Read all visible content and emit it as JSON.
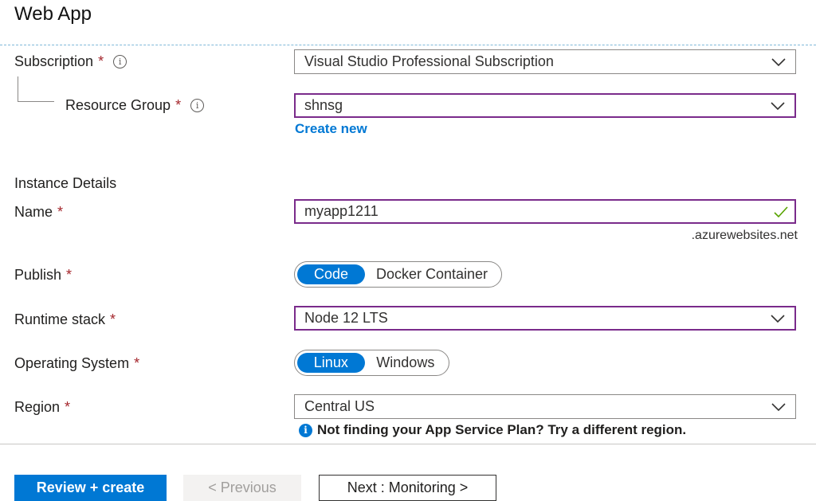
{
  "page": {
    "title": "Web App"
  },
  "subscription": {
    "label": "Subscription",
    "required": "*",
    "value": "Visual Studio Professional Subscription"
  },
  "resource_group": {
    "label": "Resource Group",
    "required": "*",
    "value": "shnsg",
    "create_new": "Create new"
  },
  "instance_details": {
    "heading": "Instance Details",
    "name": {
      "label": "Name",
      "required": "*",
      "value": "myapp1211",
      "suffix": ".azurewebsites.net"
    },
    "publish": {
      "label": "Publish",
      "required": "*",
      "options": [
        "Code",
        "Docker Container"
      ],
      "selected": "Code"
    },
    "runtime_stack": {
      "label": "Runtime stack",
      "required": "*",
      "value": "Node 12 LTS"
    },
    "os": {
      "label": "Operating System",
      "required": "*",
      "options": [
        "Linux",
        "Windows"
      ],
      "selected": "Linux"
    },
    "region": {
      "label": "Region",
      "required": "*",
      "value": "Central US",
      "hint": "Not finding your App Service Plan? Try a different region."
    }
  },
  "footer": {
    "review_create": "Review + create",
    "previous": "< Previous",
    "next": "Next : Monitoring >"
  },
  "colors": {
    "accent": "#0078d4",
    "focus_border": "#7a2b8b",
    "required": "#a4262c",
    "valid_check": "#57a300"
  },
  "icons": {
    "info": "info-icon",
    "dropdown": "chevron-down-icon",
    "valid": "checkmark-icon",
    "hint": "info-filled-icon"
  }
}
